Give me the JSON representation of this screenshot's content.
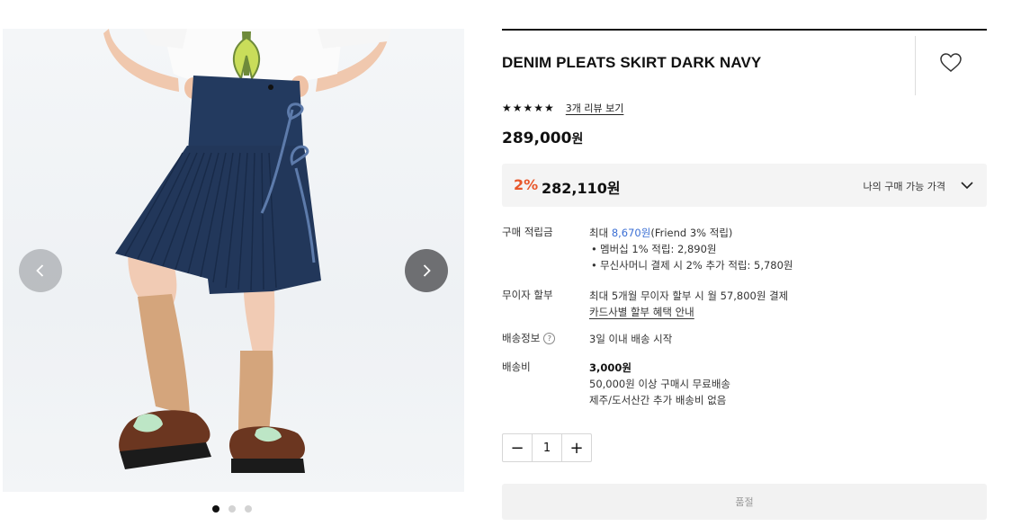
{
  "gallery": {
    "current_slide": 1,
    "total_slides": 3
  },
  "product": {
    "title": "DENIM PLEATS SKIRT DARK NAVY",
    "stars": "★★★★★",
    "review_link": "3개 리뷰 보기",
    "price": "289,000",
    "price_unit": "원"
  },
  "sale": {
    "rate": "2%",
    "price": "282,110원",
    "label": "나의 구매 가능 가격",
    "accent_color": "#e8572b"
  },
  "points": {
    "label": "구매 적립금",
    "max_prefix": "최대 ",
    "max_amount": "8,670원",
    "max_suffix": "(Friend 3% 적립)",
    "items": [
      "멤버십 1% 적립: 2,890원",
      "무신사머니 결제 시 2% 추가 적립: 5,780원"
    ]
  },
  "installment": {
    "label": "무이자 할부",
    "text": "최대 5개월 무이자 할부 시 월 57,800원 결제",
    "link": "카드사별 할부 혜택 안내"
  },
  "shipping_info": {
    "label": "배송정보",
    "help": "?",
    "text": "3일 이내 배송 시작"
  },
  "shipping_fee": {
    "label": "배송비",
    "amount": "3,000원",
    "line1": "50,000원 이상 구매시 무료배송",
    "line2": "제주/도서산간 추가 배송비 없음"
  },
  "quantity": {
    "minus": "−",
    "value": "1",
    "plus": "+"
  },
  "soldout_label": "품절"
}
